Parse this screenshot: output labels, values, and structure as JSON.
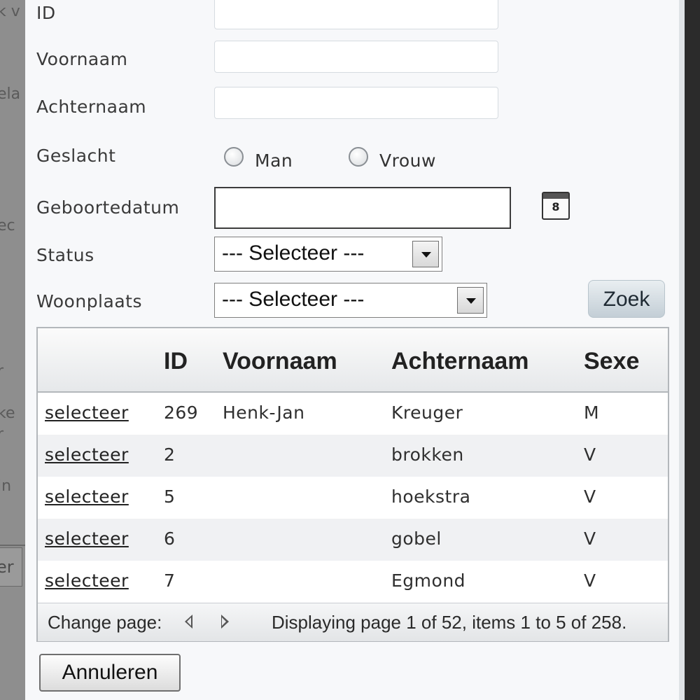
{
  "background_fragments": [
    "k v",
    "ela",
    "ec",
    "r",
    "ke",
    "r",
    "in",
    "er"
  ],
  "form": {
    "id_label": "ID",
    "voornaam_label": "Voornaam",
    "achternaam_label": "Achternaam",
    "geslacht_label": "Geslacht",
    "geslacht_options": [
      "Man",
      "Vrouw"
    ],
    "geboortedatum_label": "Geboortedatum",
    "status_label": "Status",
    "status_selected": "--- Selecteer ---",
    "woonplaats_label": "Woonplaats",
    "woonplaats_selected": "--- Selecteer ---",
    "search_button": "Zoek",
    "calendar_icon": "calendar-icon"
  },
  "grid": {
    "columns": [
      "",
      "ID",
      "Voornaam",
      "Achternaam",
      "Sexe"
    ],
    "rows": [
      {
        "action": "selecteer",
        "id": "269",
        "voornaam": "Henk-Jan",
        "achternaam": "Kreuger",
        "sexe": "M"
      },
      {
        "action": "selecteer",
        "id": "2",
        "voornaam": "",
        "achternaam": "brokken",
        "sexe": "V"
      },
      {
        "action": "selecteer",
        "id": "5",
        "voornaam": "",
        "achternaam": "hoekstra",
        "sexe": "V"
      },
      {
        "action": "selecteer",
        "id": "6",
        "voornaam": "",
        "achternaam": "gobel",
        "sexe": "V"
      },
      {
        "action": "selecteer",
        "id": "7",
        "voornaam": "",
        "achternaam": "Egmond",
        "sexe": "V"
      }
    ],
    "pager": {
      "label": "Change page:",
      "info": "Displaying page 1 of 52, items 1 to 5 of 258."
    }
  },
  "footer": {
    "cancel_button": "Annuleren"
  }
}
